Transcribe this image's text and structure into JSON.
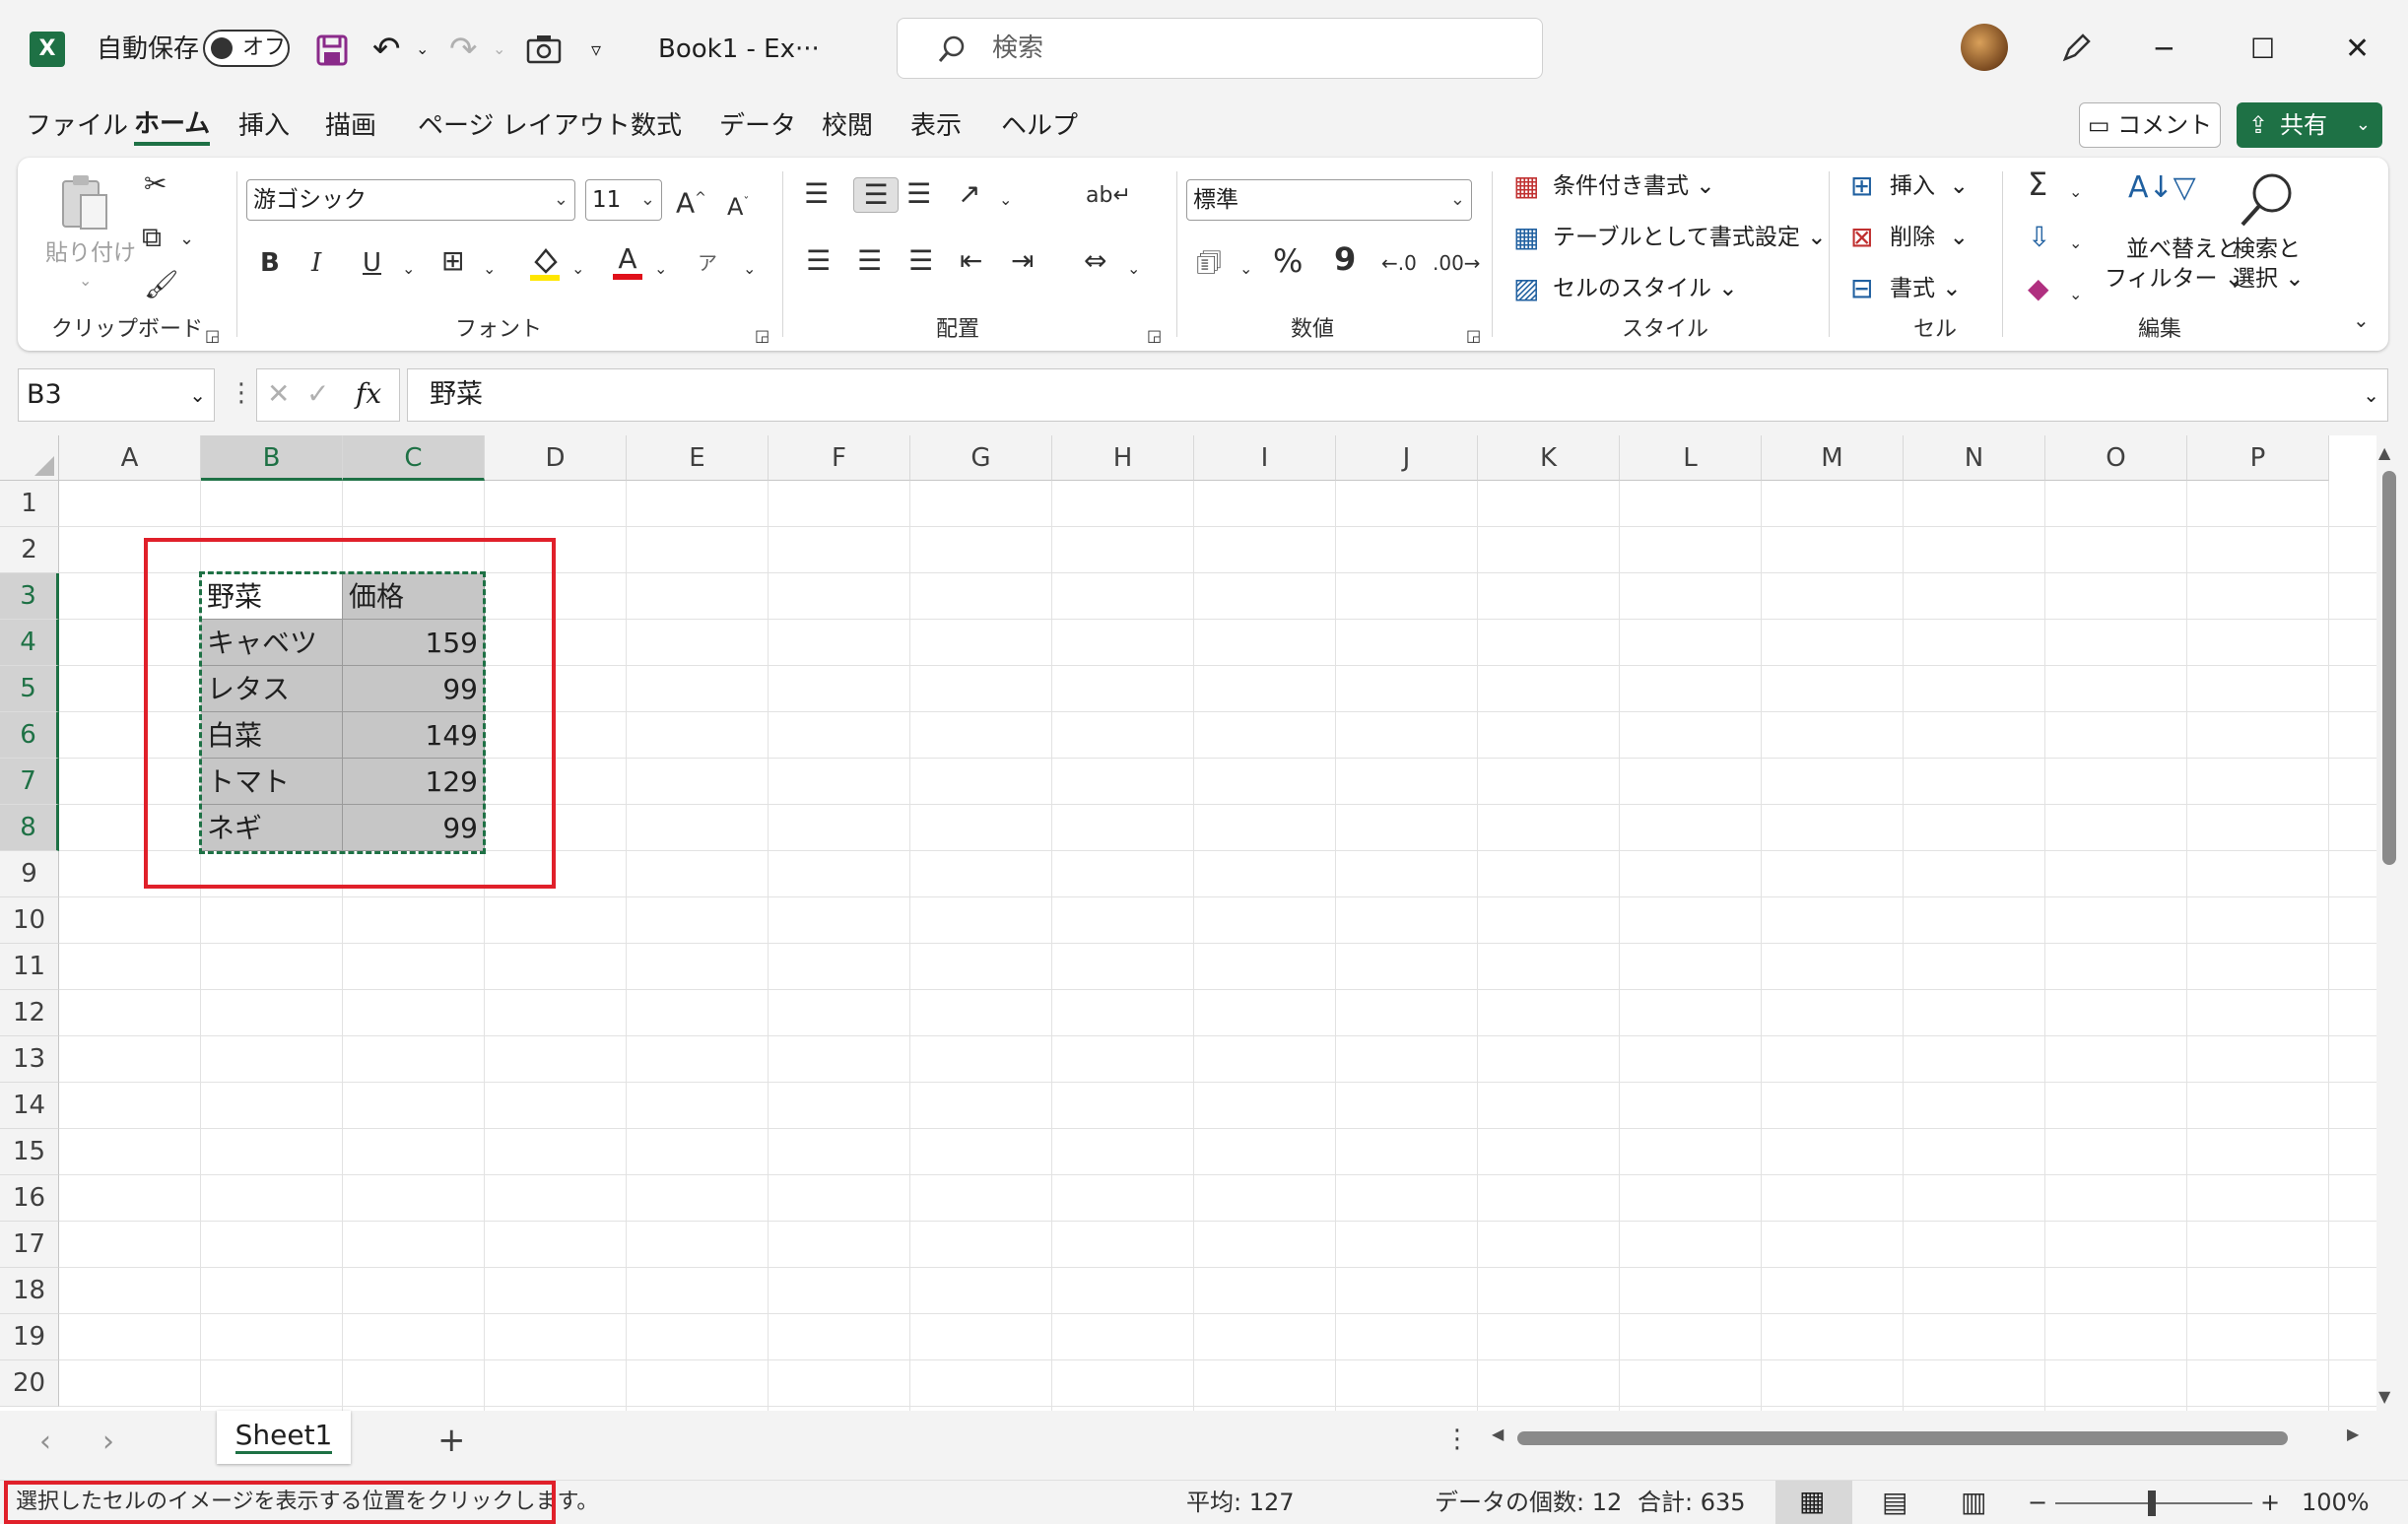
{
  "window": {
    "app_icon": "X",
    "autosave_label": "自動保存",
    "autosave_state": "オフ",
    "title": "Book1  -  Ex···",
    "search_placeholder": "検索"
  },
  "menu": [
    "ファイル",
    "ホーム",
    "挿入",
    "描画",
    "ページ レイアウト",
    "数式",
    "データ",
    "校閲",
    "表示",
    "ヘルプ"
  ],
  "buttons": {
    "comment": "コメント",
    "share": "共有"
  },
  "ribbon": {
    "clipboard": {
      "paste": "貼り付け",
      "label": "クリップボード"
    },
    "font": {
      "name": "游ゴシック",
      "size": "11",
      "bold": "B",
      "italic": "I",
      "underline": "U",
      "label": "フォント"
    },
    "alignment": {
      "label": "配置"
    },
    "number": {
      "format": "標準",
      "percent": "%",
      "comma": "9",
      "label": "数値"
    },
    "styles": {
      "conditional": "条件付き書式",
      "table": "テーブルとして書式設定",
      "cell_styles": "セルのスタイル",
      "label": "スタイル"
    },
    "cells": {
      "insert": "挿入",
      "delete": "削除",
      "format": "書式",
      "label": "セル"
    },
    "editing": {
      "sort_1": "並べ替えと",
      "sort_2": "フィルター",
      "find_1": "検索と",
      "find_2": "選択",
      "label": "編集"
    }
  },
  "formula_bar": {
    "name_box": "B3",
    "fx": "fx",
    "content": "野菜"
  },
  "columns": [
    "A",
    "B",
    "C",
    "D",
    "E",
    "F",
    "G",
    "H",
    "I",
    "J",
    "K",
    "L",
    "M",
    "N",
    "O",
    "P"
  ],
  "rows": [
    "1",
    "2",
    "3",
    "4",
    "5",
    "6",
    "7",
    "8",
    "9",
    "10",
    "11",
    "12",
    "13",
    "14",
    "15",
    "16",
    "17",
    "18",
    "19",
    "20"
  ],
  "table": {
    "header": [
      "野菜",
      "価格"
    ],
    "rows": [
      [
        "キャベツ",
        "159"
      ],
      [
        "レタス",
        "99"
      ],
      [
        "白菜",
        "149"
      ],
      [
        "トマト",
        "129"
      ],
      [
        "ネギ",
        "99"
      ]
    ]
  },
  "sheets": {
    "active": "Sheet1",
    "add": "+"
  },
  "status": {
    "message": "選択したセルのイメージを表示する位置をクリックします。",
    "average": "平均: 127",
    "count": "データの個数: 12",
    "sum": "合計: 635",
    "zoom": "100%"
  },
  "colors": {
    "accent": "#1e7145",
    "highlight": "#e0202a"
  }
}
